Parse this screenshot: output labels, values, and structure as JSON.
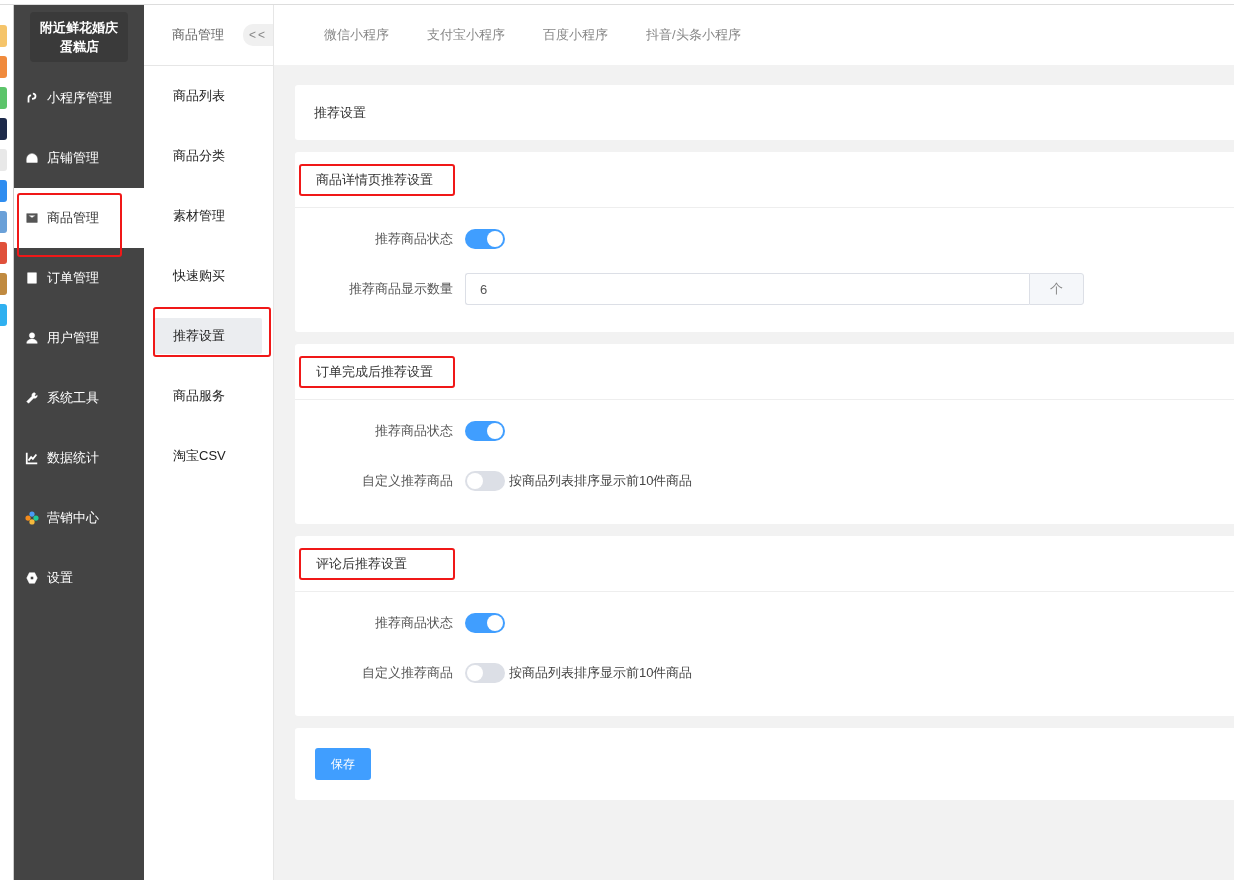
{
  "sidebar": {
    "logo": "附近鲜花婚庆蛋糕店",
    "items": [
      {
        "label": "小程序管理",
        "selected": false,
        "highlighted": false
      },
      {
        "label": "店铺管理",
        "selected": false,
        "highlighted": false
      },
      {
        "label": "商品管理",
        "selected": true,
        "highlighted": true
      },
      {
        "label": "订单管理",
        "selected": false,
        "highlighted": false
      },
      {
        "label": "用户管理",
        "selected": false,
        "highlighted": false
      },
      {
        "label": "系统工具",
        "selected": false,
        "highlighted": false
      },
      {
        "label": "数据统计",
        "selected": false,
        "highlighted": false
      },
      {
        "label": "营销中心",
        "selected": false,
        "highlighted": false
      },
      {
        "label": "设置",
        "selected": false,
        "highlighted": false
      }
    ]
  },
  "submenu": {
    "title": "商品管理",
    "collapse": "<<",
    "items": [
      {
        "label": "商品列表",
        "selected": false,
        "highlighted": false
      },
      {
        "label": "商品分类",
        "selected": false,
        "highlighted": false
      },
      {
        "label": "素材管理",
        "selected": false,
        "highlighted": false
      },
      {
        "label": "快速购买",
        "selected": false,
        "highlighted": false
      },
      {
        "label": "推荐设置",
        "selected": true,
        "highlighted": true
      },
      {
        "label": "商品服务",
        "selected": false,
        "highlighted": false
      },
      {
        "label": "淘宝CSV",
        "selected": false,
        "highlighted": false
      }
    ]
  },
  "tabs": [
    {
      "label": "微信小程序",
      "selected": false
    },
    {
      "label": "支付宝小程序",
      "selected": false
    },
    {
      "label": "百度小程序",
      "selected": false
    },
    {
      "label": "抖音/头条小程序",
      "selected": false
    }
  ],
  "page_title": "推荐设置",
  "sections": [
    {
      "title": "商品详情页推荐设置",
      "highlighted": true,
      "fields": [
        {
          "kind": "switch",
          "label": "推荐商品状态",
          "on": true
        },
        {
          "kind": "number",
          "label": "推荐商品显示数量",
          "value": "6",
          "unit": "个"
        }
      ]
    },
    {
      "title": "订单完成后推荐设置",
      "highlighted": true,
      "fields": [
        {
          "kind": "switch",
          "label": "推荐商品状态",
          "on": true
        },
        {
          "kind": "switch",
          "label": "自定义推荐商品",
          "on": false,
          "hint": "按商品列表排序显示前10件商品"
        }
      ]
    },
    {
      "title": "评论后推荐设置",
      "highlighted": true,
      "fields": [
        {
          "kind": "switch",
          "label": "推荐商品状态",
          "on": true
        },
        {
          "kind": "switch",
          "label": "自定义推荐商品",
          "on": false,
          "hint": "按商品列表排序显示前10件商品"
        }
      ]
    }
  ],
  "save_button": "保存"
}
